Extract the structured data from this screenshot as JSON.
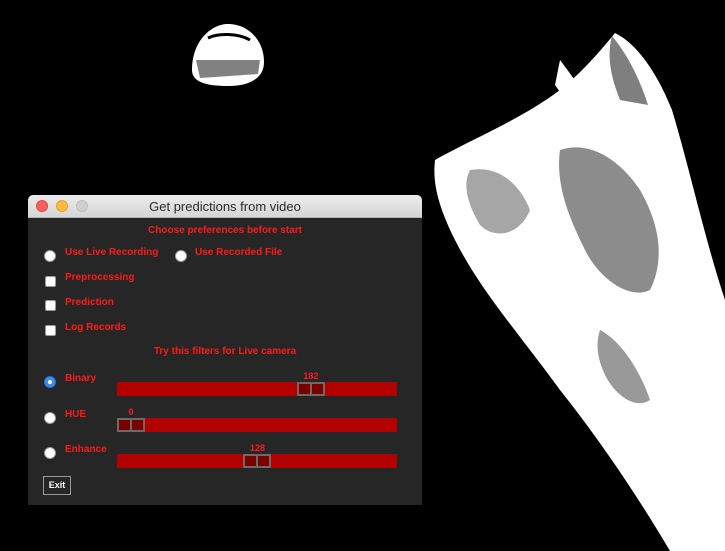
{
  "window": {
    "title": "Get predictions from video"
  },
  "preferences": {
    "heading": "Choose preferences before start",
    "source_options": [
      "Use Live Recording",
      "Use Recorded File"
    ],
    "checkboxes": [
      "Preprocessing",
      "Prediction",
      "Log Records"
    ]
  },
  "filters": {
    "heading": "Try this filters for Live camera",
    "items": [
      {
        "label": "Binary",
        "value": "182",
        "level": 182,
        "max": 255,
        "selected": true
      },
      {
        "label": "HUE",
        "value": "0",
        "level": 0,
        "max": 255,
        "selected": false
      },
      {
        "label": "Enhance",
        "value": "128",
        "level": 128,
        "max": 255,
        "selected": false
      }
    ]
  },
  "buttons": {
    "exit_label": "Exit"
  },
  "colors": {
    "label_red": "#ff1a1a",
    "slider_red": "#b30000",
    "window_bg": "#262626",
    "radio_selected": "#3b8ef0"
  }
}
